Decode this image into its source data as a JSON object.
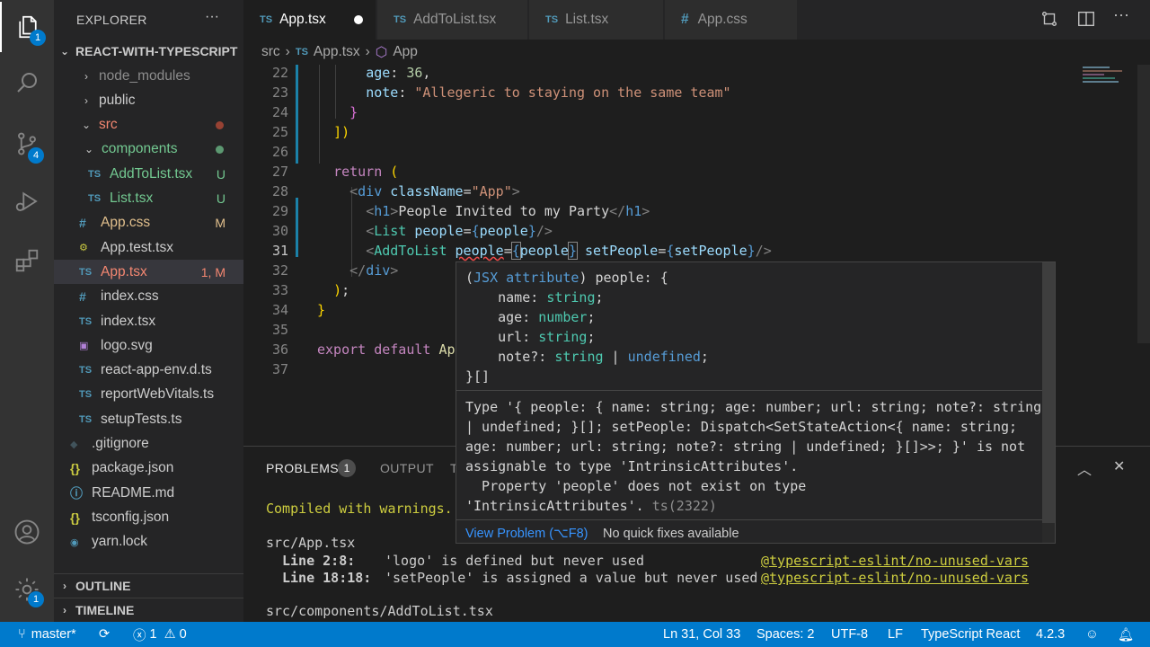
{
  "activity": {
    "explorer_badge": "1",
    "scm_badge": "4",
    "settings_badge": "1"
  },
  "sidebar": {
    "title": "EXPLORER",
    "more": "···",
    "project": "REACT-WITH-TYPESCRIPT",
    "tree": [
      {
        "label": "node_modules",
        "type": "folder-closed",
        "color": "#8c8c8c",
        "status": ""
      },
      {
        "label": "public",
        "type": "folder-closed",
        "color": "#cccccc",
        "status": ""
      },
      {
        "label": "src",
        "type": "folder-open",
        "color": "#f48771",
        "status": "dot-red"
      },
      {
        "label": "components",
        "type": "folder-open",
        "color": "#73c991",
        "status": "dot-green"
      },
      {
        "label": "AddToList.tsx",
        "type": "ts",
        "color": "#73c991",
        "status": "U"
      },
      {
        "label": "List.tsx",
        "type": "ts",
        "color": "#73c991",
        "status": "U"
      },
      {
        "label": "App.css",
        "type": "css",
        "color": "#e2c08d",
        "status": "M"
      },
      {
        "label": "App.test.tsx",
        "type": "test",
        "color": "#cccccc",
        "status": ""
      },
      {
        "label": "App.tsx",
        "type": "ts",
        "color": "#f48771",
        "status": "1, M"
      },
      {
        "label": "index.css",
        "type": "css",
        "color": "#cccccc",
        "status": ""
      },
      {
        "label": "index.tsx",
        "type": "ts",
        "color": "#cccccc",
        "status": ""
      },
      {
        "label": "logo.svg",
        "type": "svg",
        "color": "#cccccc",
        "status": ""
      },
      {
        "label": "react-app-env.d.ts",
        "type": "ts",
        "color": "#cccccc",
        "status": ""
      },
      {
        "label": "reportWebVitals.ts",
        "type": "ts",
        "color": "#cccccc",
        "status": ""
      },
      {
        "label": "setupTests.ts",
        "type": "ts",
        "color": "#cccccc",
        "status": ""
      },
      {
        "label": ".gitignore",
        "type": "git",
        "color": "#cccccc",
        "status": ""
      },
      {
        "label": "package.json",
        "type": "json",
        "color": "#cccccc",
        "status": ""
      },
      {
        "label": "README.md",
        "type": "info",
        "color": "#cccccc",
        "status": ""
      },
      {
        "label": "tsconfig.json",
        "type": "json",
        "color": "#cccccc",
        "status": ""
      },
      {
        "label": "yarn.lock",
        "type": "yarn",
        "color": "#cccccc",
        "status": ""
      }
    ],
    "outline": "OUTLINE",
    "timeline": "TIMELINE"
  },
  "tabs": [
    {
      "label": "App.tsx",
      "icon": "TS",
      "active": true,
      "modified": true
    },
    {
      "label": "AddToList.tsx",
      "icon": "TS",
      "active": false
    },
    {
      "label": "List.tsx",
      "icon": "TS",
      "active": false
    },
    {
      "label": "App.css",
      "icon": "#",
      "active": false
    }
  ],
  "breadcrumb": {
    "folder": "src",
    "file_icon": "TS",
    "file": "App.tsx",
    "symbol": "App"
  },
  "editor": {
    "lines": [
      22,
      23,
      24,
      25,
      26,
      27,
      28,
      29,
      30,
      31,
      32,
      33,
      34,
      35,
      36,
      37
    ],
    "current_line": 31,
    "code": {
      "l22_key": "age",
      "l22_val": "36",
      "l23_key": "note",
      "l23_val": "\"Allegeric to staying on the same team\"",
      "l27": "return",
      "l28_tag": "div",
      "l28_attr": "className",
      "l28_val": "\"App\"",
      "l29_tag": "h1",
      "l29_text": "People Invited to my Party",
      "l30_tag": "List",
      "l30_attr": "people",
      "l30_val": "people",
      "l31_tag": "AddToList",
      "l31_attr1": "people",
      "l31_val1": "people",
      "l31_attr2": "setPeople",
      "l31_val2": "setPeople",
      "l32_tag": "div",
      "l36_kw1": "export",
      "l36_kw2": "default",
      "l36_name": "Ap"
    }
  },
  "hover": {
    "sig_head": "(JSX attribute) people: {",
    "fields": [
      {
        "name": "name",
        "type": "string"
      },
      {
        "name": "age",
        "type": "number"
      },
      {
        "name": "url",
        "type": "string"
      },
      {
        "name": "note?",
        "type": "string | undefined"
      }
    ],
    "sig_tail": "}[]",
    "error_lines": [
      "Type '{ people: { name: string; age: number; url: string; note?: string",
      "| undefined; }[]; setPeople: Dispatch<SetStateAction<{ name: string;",
      "age: number; url: string; note?: string | undefined; }[]>>; }' is not",
      "assignable to type 'IntrinsicAttributes'.",
      "  Property 'people' does not exist on type",
      "'IntrinsicAttributes'."
    ],
    "error_code": "ts(2322)",
    "view_problem": "View Problem (⌥F8)",
    "no_fixes": "No quick fixes available"
  },
  "panel": {
    "tabs": {
      "problems": "PROBLEMS",
      "problems_count": "1",
      "output": "OUTPUT",
      "terminal_initial": "T"
    },
    "compiled": "Compiled with warnings.",
    "file1": "src/App.tsx",
    "warnings": [
      {
        "loc": "Line 2:8:",
        "msg": "'logo' is defined but never used",
        "rule": "@typescript-eslint/no-unused-vars"
      },
      {
        "loc": "Line 18:18:",
        "msg": "'setPeople' is assigned a value but never used",
        "rule": "@typescript-eslint/no-unused-vars"
      }
    ],
    "file2": "src/components/AddToList.tsx"
  },
  "status": {
    "branch": "master*",
    "errors": "1",
    "warnings": "0",
    "position": "Ln 31, Col 33",
    "spaces": "Spaces: 2",
    "encoding": "UTF-8",
    "eol": "LF",
    "language": "TypeScript React",
    "version": "4.2.3"
  },
  "colors": {
    "accent": "#007acc",
    "sidebar": "#252526",
    "editor": "#1e1e1e",
    "activity": "#333333"
  }
}
